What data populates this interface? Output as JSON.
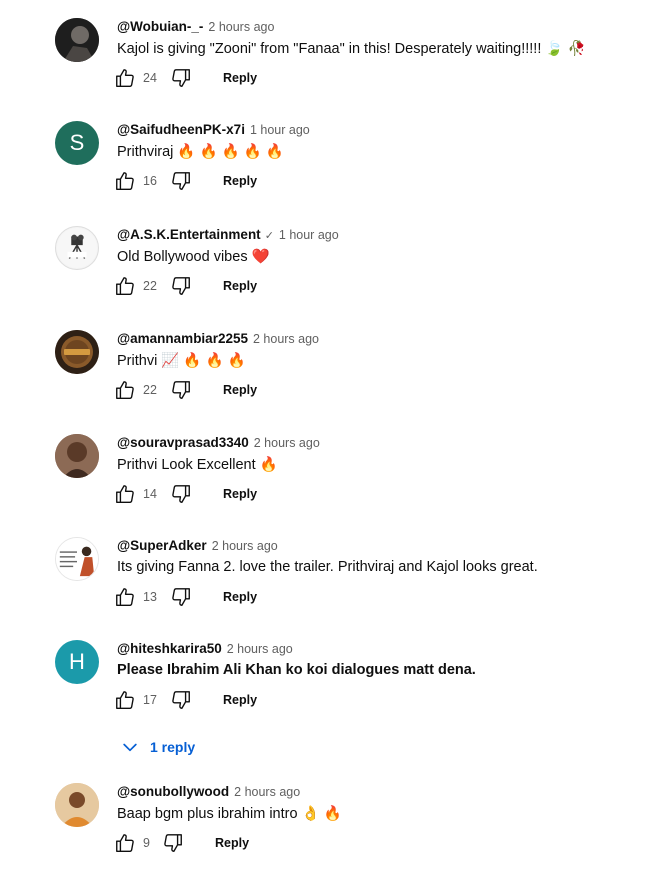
{
  "comments": [
    {
      "author": "@Wobuian-_-",
      "time": "2 hours ago",
      "text": "Kajol is giving \"Zooni\" from \"Fanaa\" in this! Desperately waiting!!!!! 🍃 🥀",
      "likes": "24",
      "reply": "Reply"
    },
    {
      "author": "@SaifudheenPK-x7i",
      "time": "1 hour ago",
      "text": "Prithviraj 🔥 🔥 🔥 🔥 🔥",
      "likes": "16",
      "reply": "Reply",
      "avatar_letter": "S",
      "avatar_color": "#1f6e5c"
    },
    {
      "author": "@A.S.K.Entertainment",
      "verified": "✓",
      "time": "1 hour ago",
      "text": "Old Bollywood vibes ❤️",
      "likes": "22",
      "reply": "Reply"
    },
    {
      "author": "@amannambiar2255",
      "time": "2 hours ago",
      "text": "Prithvi 📈 🔥 🔥 🔥",
      "likes": "22",
      "reply": "Reply"
    },
    {
      "author": "@souravprasad3340",
      "time": "2 hours ago",
      "text": "Prithvi Look Excellent 🔥",
      "likes": "14",
      "reply": "Reply"
    },
    {
      "author": "@SuperAdker",
      "time": "2 hours ago",
      "text": "Its giving Fanna 2. love the trailer. Prithviraj and Kajol looks great.",
      "likes": "13",
      "reply": "Reply"
    },
    {
      "author": "@hiteshkarira50",
      "time": "2 hours ago",
      "text": "Please Ibrahim Ali Khan ko koi dialogues matt dena.",
      "likes": "17",
      "reply": "Reply",
      "avatar_letter": "H",
      "avatar_color": "#1b9aaa"
    },
    {
      "author": "@sonubollywood",
      "time": "2 hours ago",
      "text": "Baap bgm plus ibrahim intro 👌 🔥",
      "likes": "9",
      "reply": "Reply"
    }
  ],
  "replies_toggle": {
    "label": "1 reply"
  },
  "colors": {
    "link_blue": "#065fd4",
    "meta_gray": "#606060"
  },
  "icons": [
    "like-icon",
    "dislike-icon",
    "chevron-down-icon",
    "verified-check-icon"
  ]
}
